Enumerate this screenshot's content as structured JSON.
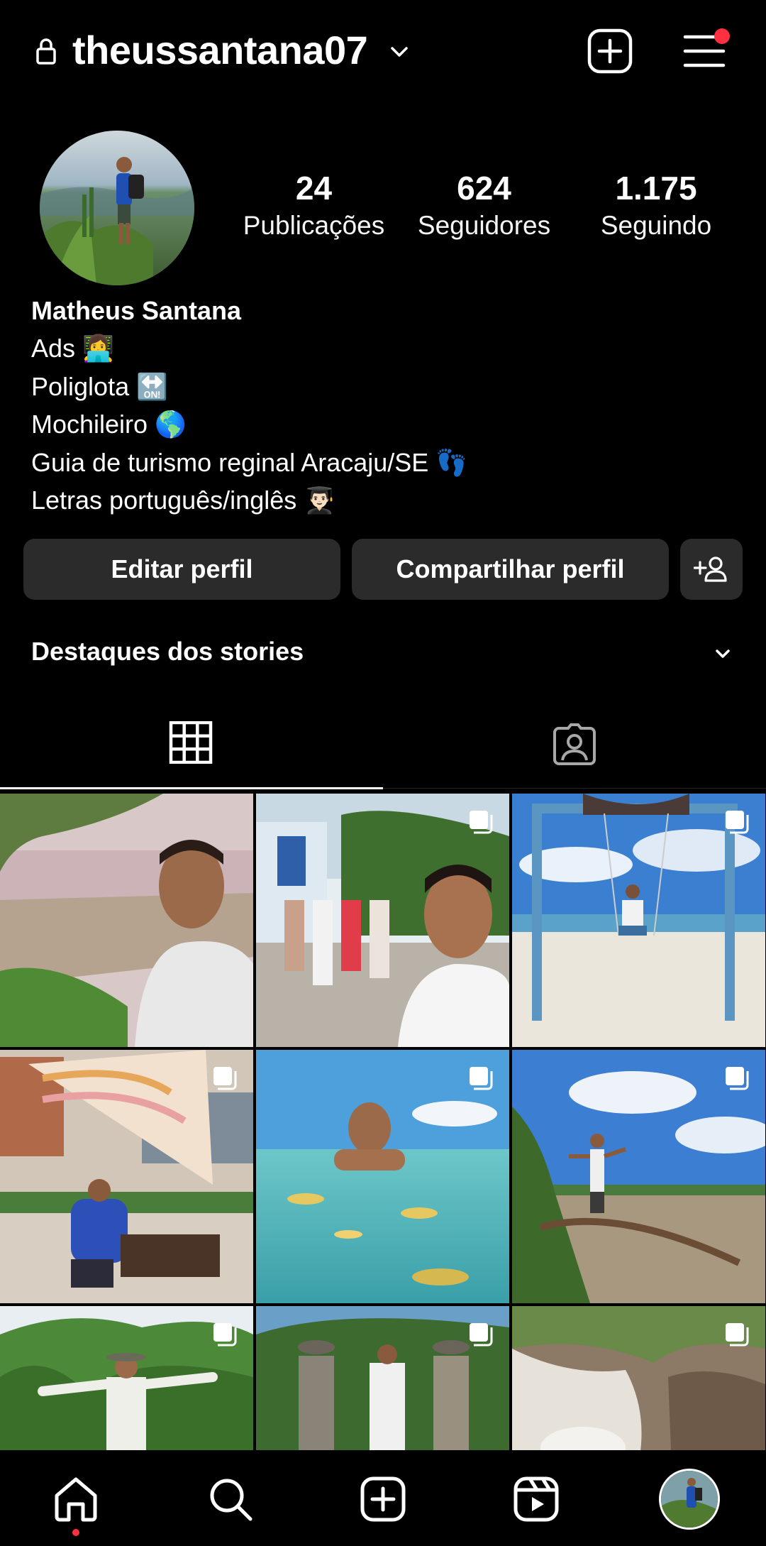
{
  "header": {
    "username": "theussantana07",
    "lock_icon": "lock-icon",
    "new_post_icon": "plus-square-icon",
    "menu_icon": "hamburger-menu-icon",
    "notification_color": "#ff3040"
  },
  "profile": {
    "stats": [
      {
        "value": "24",
        "label": "Publicações"
      },
      {
        "value": "624",
        "label": "Seguidores"
      },
      {
        "value": "1.175",
        "label": "Seguindo"
      }
    ],
    "name": "Matheus Santana",
    "bio": [
      "Ads 👩‍💻",
      "Poliglota 🔛",
      "Mochileiro 🌎",
      "Guia de turismo reginal Aracaju/SE 👣",
      "Letras português/inglês 👨🏻‍🎓"
    ]
  },
  "actions": {
    "edit_label": "Editar perfil",
    "share_label": "Compartilhar perfil",
    "discover_icon": "add-person-icon"
  },
  "highlights": {
    "label": "Destaques dos stories"
  },
  "tabs": [
    {
      "name": "grid",
      "icon": "grid-icon",
      "active": true
    },
    {
      "name": "tagged",
      "icon": "tagged-person-icon",
      "active": false
    }
  ],
  "bottom_nav": [
    {
      "name": "home",
      "icon": "home-icon",
      "active": true
    },
    {
      "name": "search",
      "icon": "search-icon"
    },
    {
      "name": "create",
      "icon": "plus-square-icon"
    },
    {
      "name": "reels",
      "icon": "reels-icon"
    },
    {
      "name": "profile",
      "icon": "avatar"
    }
  ],
  "colors": {
    "background": "#000000",
    "button_bg": "#2b2b2b",
    "accent_red": "#ff3040"
  }
}
